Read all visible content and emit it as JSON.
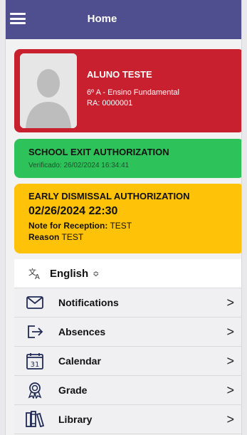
{
  "header": {
    "title": "Home",
    "menu_icon": "hamburger-menu-icon"
  },
  "student": {
    "name": "ALUNO TESTE",
    "class": "6º A - Ensino Fundamental",
    "ra": "RA: 0000001",
    "card_color": "#c8202f"
  },
  "exit_authorization": {
    "title": "SCHOOL EXIT AUTHORIZATION",
    "verified": "Verificado: 26/02/2024 16:34:41",
    "card_color": "#2ec25a"
  },
  "early_dismissal": {
    "title": "EARLY DISMISSAL AUTHORIZATION",
    "datetime": "02/26/2024 22:30",
    "note_label": "Note for Reception:",
    "note_value": "TEST",
    "reason_label": "Reason",
    "reason_value": "TEST",
    "card_color": "#fec308"
  },
  "language": {
    "icon": "translate-icon",
    "value": "English",
    "caret": "≎"
  },
  "menu": [
    {
      "label": "Notifications",
      "icon": "envelope-icon"
    },
    {
      "label": "Absences",
      "icon": "exit-arrow-icon"
    },
    {
      "label": "Calendar",
      "icon": "calendar-icon",
      "icon_text": "31"
    },
    {
      "label": "Grade",
      "icon": "award-ribbon-icon"
    },
    {
      "label": "Library",
      "icon": "books-icon"
    }
  ],
  "chevron": ">",
  "colors": {
    "appbar": "#4f4f8f",
    "accent_text": "#ffffff"
  }
}
